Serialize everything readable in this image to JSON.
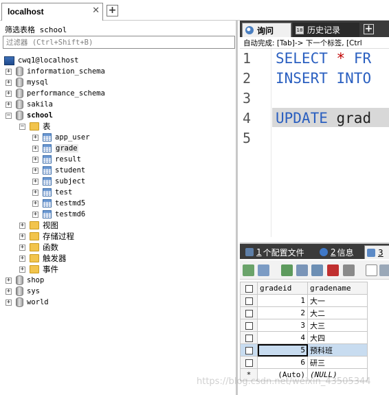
{
  "window": {
    "connection_tab": "localhost",
    "close_glyph": "✕",
    "add_glyph": "+"
  },
  "navigator": {
    "filter_label": "筛选表格 school",
    "filter_placeholder": "过滤器 (Ctrl+Shift+B)",
    "root": "cwq1@localhost",
    "databases": [
      {
        "name": "information_schema"
      },
      {
        "name": "mysql"
      },
      {
        "name": "performance_schema"
      },
      {
        "name": "sakila"
      },
      {
        "name": "school",
        "expanded": true
      },
      {
        "name": "shop"
      },
      {
        "name": "sys"
      },
      {
        "name": "world"
      }
    ],
    "school": {
      "tables_folder": "表",
      "tables": [
        "app_user",
        "grade",
        "result",
        "student",
        "subject",
        "test",
        "testmd5",
        "testmd6"
      ],
      "selected_table": "grade",
      "other_folders": [
        "视图",
        "存储过程",
        "函数",
        "触发器",
        "事件"
      ]
    },
    "expand_glyph_collapsed": "+",
    "expand_glyph_expanded": "−"
  },
  "editor": {
    "tabs": {
      "query": "询问",
      "history": "历史记录",
      "history_icon_text": "18",
      "add": "+"
    },
    "hint": "自动完成: [Tab]-> 下一个标签, [Ctrl",
    "line_numbers": [
      "1",
      "2",
      "3",
      "4",
      "5"
    ],
    "lines": [
      {
        "kw": "SELECT",
        "op": "*",
        "rest": "FR"
      },
      {
        "kw": "INSERT",
        "rest": "INTO"
      },
      {},
      {
        "kw": "UPDATE",
        "rest": "grad"
      },
      {}
    ],
    "highlight_line": 4
  },
  "results": {
    "tabs": [
      {
        "num": "1",
        "label": "个配置文件"
      },
      {
        "num": "2",
        "label": "信息"
      },
      {
        "num": "3",
        "label": ""
      }
    ],
    "columns": [
      "gradeid",
      "gradename"
    ],
    "rows": [
      {
        "gradeid": "1",
        "gradename": "大一"
      },
      {
        "gradeid": "2",
        "gradename": "大二"
      },
      {
        "gradeid": "3",
        "gradename": "大三"
      },
      {
        "gradeid": "4",
        "gradename": "大四"
      },
      {
        "gradeid": "5",
        "gradename": "预科班",
        "selected": true
      },
      {
        "gradeid": "6",
        "gradename": "研三"
      }
    ],
    "new_row": {
      "marker": "*",
      "gradeid": "(Auto)",
      "gradename": "(NULL)"
    },
    "selected_row_index": 4
  },
  "watermark": "https://blog.csdn.net/weixin_43505344",
  "colors": {
    "keyword": "#2a5fc0",
    "operator": "#c00000",
    "dark_tab_bar": "#3a3a3a",
    "selection": "#c8dcf0"
  }
}
